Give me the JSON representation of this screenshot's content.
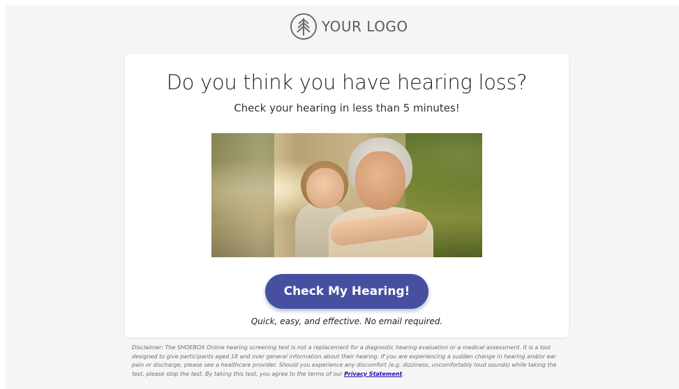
{
  "logo": {
    "text": "YOUR LOGO",
    "icon": "tree-circle-icon"
  },
  "hero": {
    "headline": "Do you think you have hearing loss?",
    "subheadline": "Check your hearing in less than 5 minutes!"
  },
  "cta": {
    "button_label": "Check My Hearing!",
    "tagline": "Quick, easy, and effective. No email required."
  },
  "disclaimer": {
    "text": "Disclaimer: The SHOEBOX Online hearing screening test is not a replacement for a diagnostic hearing evaluation or a medical assessment. It is a tool designed to give participants aged 18 and over general information about their hearing. If you are experiencing a sudden change in hearing and/or ear pain or discharge, please see a healthcare provider. Should you experience any discomfort (e.g. dizziness, uncomfortably loud sounds) while taking the test, please stop the test. By taking this test, you agree to the terms of our ",
    "link_label": "Privacy Statement",
    "suffix": "."
  },
  "colors": {
    "background": "#f5f5f5",
    "card": "#ffffff",
    "button": "#4750a0",
    "link": "#1a0dab"
  }
}
